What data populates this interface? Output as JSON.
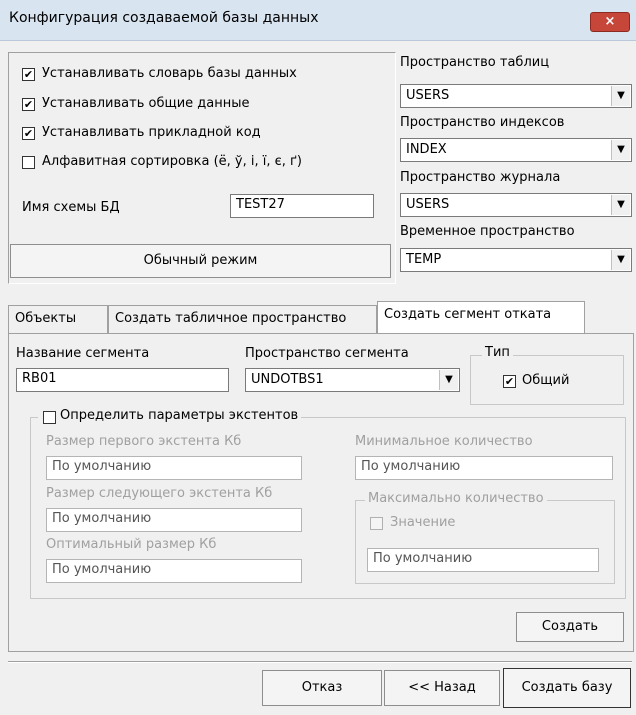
{
  "window": {
    "title": "Конфигурация создаваемой базы данных",
    "close_icon": "×"
  },
  "options": {
    "checks": [
      {
        "label": "Устанавливать словарь базы данных",
        "checked": true
      },
      {
        "label": "Устанавливать общие данные",
        "checked": true
      },
      {
        "label": "Устанавливать прикладной код",
        "checked": true
      },
      {
        "label": "Алфавитная сортировка (ё, ў, і, ї, є, ґ)",
        "checked": false
      }
    ],
    "schema_label": "Имя схемы БД",
    "schema_value": "TEST27",
    "mode_button": "Обычный режим"
  },
  "spaces": {
    "tables_label": "Пространство таблиц",
    "tables_value": "USERS",
    "indexes_label": "Пространство индексов",
    "indexes_value": "INDEX",
    "journal_label": "Пространство журнала",
    "journal_value": "USERS",
    "temp_label": "Временное пространство",
    "temp_value": "TEMP"
  },
  "tabs": [
    "Объекты",
    "Создать табличное пространство",
    "Создать сегмент отката"
  ],
  "segment": {
    "name_label": "Название сегмента",
    "name_value": "RB01",
    "space_label": "Пространство сегмента",
    "space_value": "UNDOTBS1",
    "type_label": "Тип",
    "type_option": "Общий"
  },
  "extents": {
    "group_label": "Определить параметры экстентов",
    "first_label": "Размер первого экстента Кб",
    "first_value": "По умолчанию",
    "next_label": "Размер следующего экстента Кб",
    "next_value": "По умолчанию",
    "optimal_label": "Оптимальный размер Кб",
    "optimal_value": "По умолчанию",
    "min_label": "Минимальное количество",
    "min_value": "По умолчанию",
    "max_group": "Максимально количество",
    "max_check": "Значение",
    "max_value": "По умолчанию"
  },
  "buttons": {
    "create": "Создать",
    "cancel": "Отказ",
    "back": "<< Назад",
    "create_db": "Создать базу"
  },
  "icons": {
    "check": "✔",
    "dropdown": "▼"
  }
}
